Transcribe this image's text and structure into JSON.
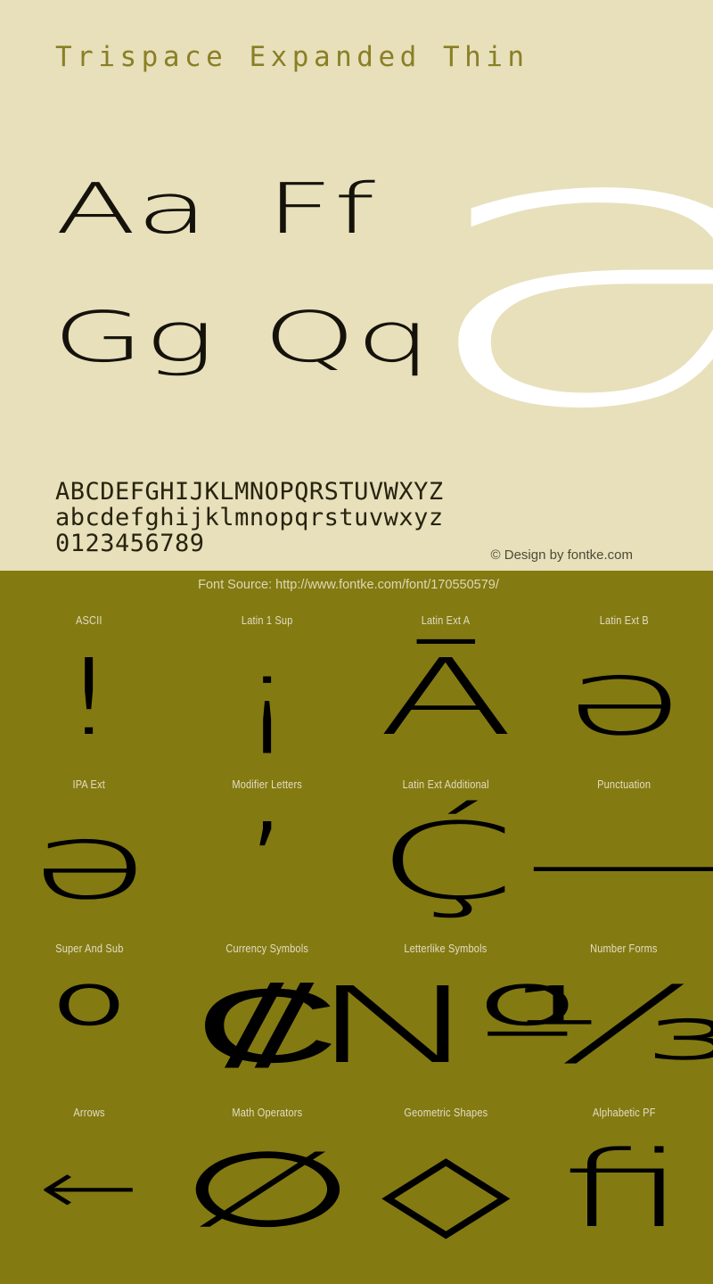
{
  "colors": {
    "top_background": "#e7e0bb",
    "bottom_background": "#847a12",
    "title_text": "#8a7f25",
    "glyph_black": "#000000",
    "showcase_white": "#ffffff",
    "label_text": "#e2ddc4"
  },
  "header": {
    "title": "Trispace Expanded Thin"
  },
  "specimen": {
    "showcase_glyph": "a",
    "pairs": [
      {
        "label": "Aa"
      },
      {
        "label": "Ff"
      },
      {
        "label": "Gg"
      },
      {
        "label": "Qq"
      }
    ],
    "alphabet_rows": [
      "ABCDEFGHIJKLMNOPQRSTUVWXYZ",
      "abcdefghijklmnopqrstuvwxyz",
      "0123456789"
    ],
    "copyright": "© Design by fontke.com"
  },
  "footer": {
    "font_source": "Font Source: http://www.fontke.com/font/170550579/"
  },
  "unicode_blocks": [
    {
      "label": "ASCII",
      "glyph": "!"
    },
    {
      "label": "Latin 1 Sup",
      "glyph": "¡"
    },
    {
      "label": "Latin Ext A",
      "glyph": "Ā"
    },
    {
      "label": "Latin Ext B",
      "glyph": "ǝ"
    },
    {
      "label": "IPA Ext",
      "glyph": "ǝ"
    },
    {
      "label": "Modifier Letters",
      "glyph": "ʼ"
    },
    {
      "label": "Latin Ext Additional",
      "glyph": "Ḉ"
    },
    {
      "label": "Punctuation",
      "glyph": "—"
    },
    {
      "label": "Super And Sub",
      "glyph": "⁰"
    },
    {
      "label": "Currency Symbols",
      "glyph": "₡"
    },
    {
      "label": "Letterlike Symbols",
      "glyph": "№"
    },
    {
      "label": "Number Forms",
      "glyph": "⅓"
    },
    {
      "label": "Arrows",
      "glyph": "←"
    },
    {
      "label": "Math Operators",
      "glyph": "∅"
    },
    {
      "label": "Geometric Shapes",
      "glyph": "◇"
    },
    {
      "label": "Alphabetic PF",
      "glyph": "ﬁ"
    }
  ]
}
